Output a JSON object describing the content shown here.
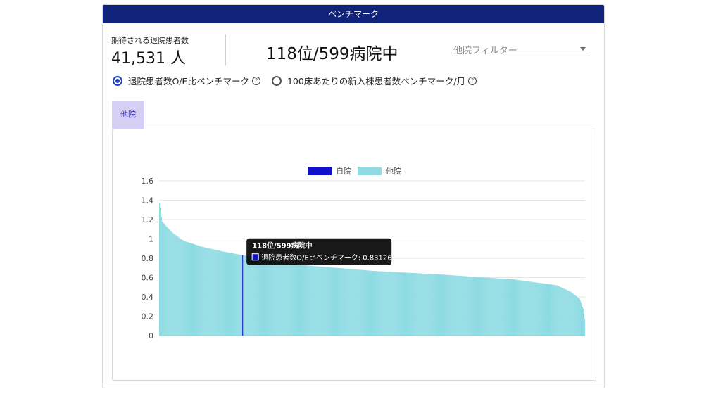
{
  "header": {
    "title": "ベンチマーク"
  },
  "stats": {
    "label": "期待される退院患者数",
    "value": "41,531 人"
  },
  "rank": {
    "text": "118位/599病院中"
  },
  "filter": {
    "placeholder": "他院フィルター"
  },
  "options": [
    {
      "label": "退院患者数O/E比ベンチマーク",
      "selected": true
    },
    {
      "label": "100床あたりの新入棟患者数ベンチマーク/月",
      "selected": false
    }
  ],
  "tabs": [
    {
      "label": "他院",
      "active": true
    }
  ],
  "icons": {
    "help": "question-circle-icon",
    "dropdown": "chevron-down-icon"
  },
  "colors": {
    "header": "#10227a",
    "own": "#1010cc",
    "other": "#8fdbe3",
    "accent": "#1e3fb8"
  },
  "chart_data": {
    "type": "bar",
    "n_bars": 599,
    "ylim": [
      0,
      1.6
    ],
    "yticks": [
      "0",
      "0.2",
      "0.4",
      "0.6",
      "0.8",
      "1",
      "1.2",
      "1.4",
      "1.6"
    ],
    "legend": [
      "自院",
      "他院"
    ],
    "legend_position": "top-center",
    "highlight_rank": 118,
    "highlight_value": 0.83126,
    "value_profile": [
      [
        1,
        1.37
      ],
      [
        5,
        1.18
      ],
      [
        12,
        1.12
      ],
      [
        20,
        1.06
      ],
      [
        35,
        0.98
      ],
      [
        60,
        0.92
      ],
      [
        90,
        0.87
      ],
      [
        118,
        0.83126
      ],
      [
        200,
        0.73
      ],
      [
        300,
        0.67
      ],
      [
        400,
        0.63
      ],
      [
        500,
        0.58
      ],
      [
        560,
        0.52
      ],
      [
        580,
        0.45
      ],
      [
        592,
        0.38
      ],
      [
        597,
        0.28
      ],
      [
        599,
        0.17
      ]
    ],
    "tooltip": {
      "title": "118位/599病院中",
      "line": "退院患者数O/E比ベンチマーク: 0.83126"
    }
  }
}
